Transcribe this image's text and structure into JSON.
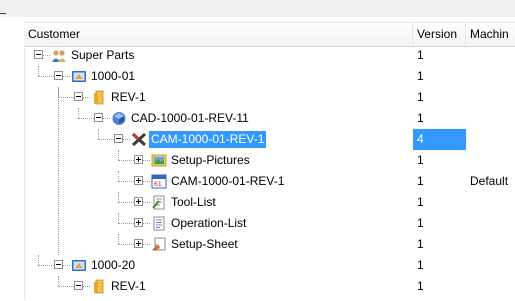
{
  "columns": {
    "customer": "Customer",
    "version": "Version",
    "machine": "Machin"
  },
  "rows": [
    {
      "label": "Super Parts",
      "version": "1",
      "machine": "",
      "icon": "customer-icon",
      "level": 0,
      "expander": "minus"
    },
    {
      "label": "1000-01",
      "version": "1",
      "machine": "",
      "icon": "part-icon",
      "level": 1,
      "expander": "minus"
    },
    {
      "label": "REV-1",
      "version": "1",
      "machine": "",
      "icon": "revision-folder-icon",
      "level": 2,
      "expander": "minus"
    },
    {
      "label": "CAD-1000-01-REV-11",
      "version": "1",
      "machine": "",
      "icon": "cad-model-icon",
      "level": 3,
      "expander": "minus"
    },
    {
      "label": "CAM-1000-01-REV-1",
      "version": "4",
      "machine": "",
      "icon": "cam-icon",
      "level": 4,
      "expander": "minus",
      "selected": true
    },
    {
      "label": "Setup-Pictures",
      "version": "1",
      "machine": "",
      "icon": "pictures-icon",
      "level": 5,
      "expander": "plus"
    },
    {
      "label": "CAM-1000-01-REV-1",
      "version": "1",
      "machine": "Default",
      "icon": "cam-program-icon",
      "level": 5,
      "expander": "plus"
    },
    {
      "label": "Tool-List",
      "version": "1",
      "machine": "",
      "icon": "tool-list-icon",
      "level": 5,
      "expander": "plus"
    },
    {
      "label": "Operation-List",
      "version": "1",
      "machine": "",
      "icon": "operation-list-icon",
      "level": 5,
      "expander": "plus"
    },
    {
      "label": "Setup-Sheet",
      "version": "1",
      "machine": "",
      "icon": "setup-sheet-icon",
      "level": 5,
      "expander": "plus"
    },
    {
      "label": "1000-20",
      "version": "1",
      "machine": "",
      "icon": "part-icon",
      "level": 1,
      "expander": "minus"
    },
    {
      "label": "REV-1",
      "version": "1",
      "machine": "",
      "icon": "revision-folder-icon",
      "level": 2,
      "expander": "minus"
    }
  ],
  "colors": {
    "selection": "#3399ff",
    "selection_text": "#ffffff"
  }
}
